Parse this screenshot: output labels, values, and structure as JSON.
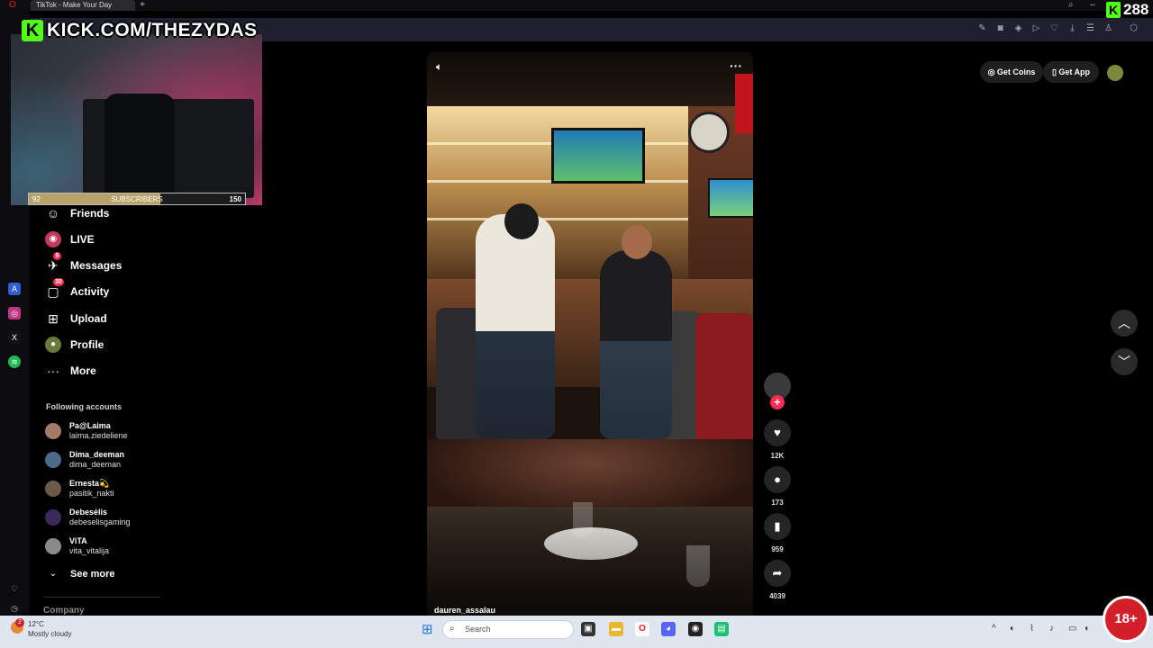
{
  "browser": {
    "tab_title": "TikTok - Make Your Day",
    "new_tab": "+"
  },
  "stream": {
    "kick_logo": "K",
    "channel": "KICK.COM/THEZYDAS",
    "sub_current": "92",
    "sub_label": "SUBSCRIBERS",
    "sub_goal": "150",
    "sub_progress": 0.61,
    "viewer_count": "288"
  },
  "nav": {
    "items": [
      {
        "label": "Friends",
        "icon": "friends-icon",
        "glyph": "☺",
        "badge": ""
      },
      {
        "label": "LIVE",
        "icon": "live-icon",
        "glyph": "◉",
        "badge": ""
      },
      {
        "label": "Messages",
        "icon": "messages-icon",
        "glyph": "✈",
        "badge": "9"
      },
      {
        "label": "Activity",
        "icon": "activity-icon",
        "glyph": "▢",
        "badge": "30"
      },
      {
        "label": "Upload",
        "icon": "upload-icon",
        "glyph": "⊞",
        "badge": ""
      },
      {
        "label": "Profile",
        "icon": "profile-icon",
        "glyph": "●",
        "badge": ""
      },
      {
        "label": "More",
        "icon": "more-icon",
        "glyph": "···",
        "badge": ""
      }
    ],
    "following_title": "Following accounts",
    "accounts": [
      {
        "name": "Pa@Laima",
        "user": "laima.ziedeliene",
        "color": "#a07a6a"
      },
      {
        "name": "Dima_deeman",
        "user": "dima_deeman",
        "color": "#4d6a8a"
      },
      {
        "name": "Ernesta💫",
        "user": "pasitik_nakti",
        "color": "#6a5a4a"
      },
      {
        "name": "Debesėlis",
        "user": "debeselisgaming",
        "color": "#3a2a5a"
      },
      {
        "name": "ViTA",
        "user": "vita_vitalija",
        "color": "#8a8a8a"
      }
    ],
    "see_more": "See more",
    "company": "Company"
  },
  "video": {
    "author": "dauren_assalau",
    "likes": "12K",
    "comments": "173",
    "saves": "959",
    "shares": "4039"
  },
  "top_right": {
    "get_coins": "Get Coins",
    "get_app": "Get App"
  },
  "taskbar": {
    "temperature": "12°C",
    "weather": "Mostly cloudy",
    "weather_badge": "2",
    "search_placeholder": "Search",
    "age_badge": "18+"
  },
  "colors": {
    "tiktok_red": "#fe2c55",
    "kick_green": "#53fc18",
    "toolbar": "#1e2030"
  }
}
